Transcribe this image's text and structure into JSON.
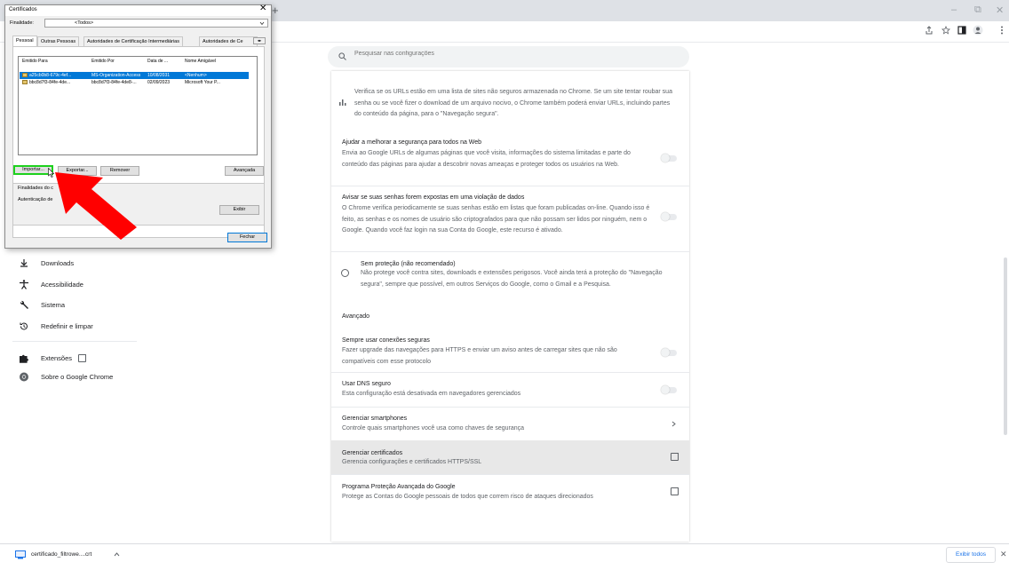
{
  "browser": {
    "new_tab_glyph": "+",
    "controls": {
      "minimize": "–",
      "restore": "⧉",
      "close": "✕"
    },
    "toolbar_icons": [
      "share-icon",
      "star-icon",
      "sidepanel-icon",
      "profile-icon",
      "menu-icon"
    ]
  },
  "search": {
    "placeholder": "Pesquisar nas configurações"
  },
  "sidebar": {
    "items": [
      {
        "label": "Downloads",
        "icon": "download-icon"
      },
      {
        "label": "Acessibilidade",
        "icon": "accessibility-icon"
      },
      {
        "label": "Sistema",
        "icon": "wrench-icon"
      },
      {
        "label": "Redefinir e limpar",
        "icon": "reset-icon"
      },
      {
        "label": "Extensões",
        "icon": "puzzle-icon"
      },
      {
        "label": "Sobre o Google Chrome",
        "icon": "chrome-icon"
      }
    ]
  },
  "settings": {
    "safe_check_text": "Verifica se os URLs estão em uma lista de sites não seguros armazenada no Chrome. Se um site tentar roubar sua senha ou se você fizer o download de um arquivo nocivo, o Chrome também poderá enviar URLs, incluindo partes do conteúdo da página, para o \"Navegação segura\".",
    "help_improve": {
      "title": "Ajudar a melhorar a segurança para todos na Web",
      "desc": "Envia ao Google URLs de algumas páginas que você visita, informações do sistema limitadas e parte do conteúdo das páginas para ajudar a descobrir novas ameaças e proteger todos os usuários na Web."
    },
    "password_leak": {
      "title": "Avisar se suas senhas forem expostas em uma violação de dados",
      "desc": "O Chrome verifica periodicamente se suas senhas estão em listas que foram publicadas on-line. Quando isso é feito, as senhas e os nomes de usuário são criptografados para que não possam ser lidos por ninguém, nem o Google. Quando você faz login na sua Conta do Google, este recurso é ativado."
    },
    "no_protection": {
      "title": "Sem proteção (não recomendado)",
      "desc": "Não protege você contra sites, downloads e extensões perigosos. Você ainda terá a proteção do \"Navegação segura\", sempre que possível, em outros Serviços do Google, como o Gmail e a Pesquisa."
    },
    "advanced_header": "Avançado",
    "https": {
      "title": "Sempre usar conexões seguras",
      "desc": "Fazer upgrade das navegações para HTTPS e enviar um aviso antes de carregar sites que não são compatíveis com esse protocolo"
    },
    "dns": {
      "title": "Usar DNS seguro",
      "desc": "Esta configuração está desativada em navegadores gerenciados"
    },
    "phones": {
      "title": "Gerenciar smartphones",
      "desc": "Controle quais smartphones você usa como chaves de segurança"
    },
    "certs": {
      "title": "Gerenciar certificados",
      "desc": "Gerencia configurações e certificados HTTPS/SSL"
    },
    "advanced_protection": {
      "title": "Programa Proteção Avançada do Google",
      "desc": "Protege as Contas do Google pessoais de todos que correm risco de ataques direcionados"
    }
  },
  "download_bar": {
    "file_name": "certificado_filtrowe....crt",
    "show_all": "Exibir todos",
    "close": "✕",
    "chevron": "^"
  },
  "dialog": {
    "title": "Certificados",
    "close": "✕",
    "purpose_label": "Finalidade:",
    "purpose_value": "<Todos>",
    "tabs": [
      "Pessoal",
      "Outras Pessoas",
      "Autoridades de Certificação Intermediárias",
      "Autoridades de Ce"
    ],
    "columns": [
      "Emitido Para",
      "Emitido Por",
      "Data de ...",
      "Nome Amigável"
    ],
    "rows": [
      {
        "issued_to": "a25cb0b8-679c-4ef...",
        "issued_by": "MS-Organization-Access",
        "date": "10/08/2031",
        "friendly": "<Nenhum>"
      },
      {
        "issued_to": "bbc8d7f3-84fe-4de...",
        "issued_by": "bbc8d7f3-84fe-4de8-...",
        "date": "02/09/2023",
        "friendly": "Microsoft Your P..."
      }
    ],
    "buttons": {
      "import": "Importar...",
      "export": "Exportar...",
      "remove": "Remover",
      "advanced": "Avançada",
      "view": "Exibir",
      "close": "Fechar"
    },
    "purposes_label": "Finalidades do c",
    "purposes_value": "Autenticação de",
    "accent": "#0078d7",
    "focus_color": "#1dd11d"
  },
  "annotation": {
    "arrow_color": "#ff0000"
  }
}
